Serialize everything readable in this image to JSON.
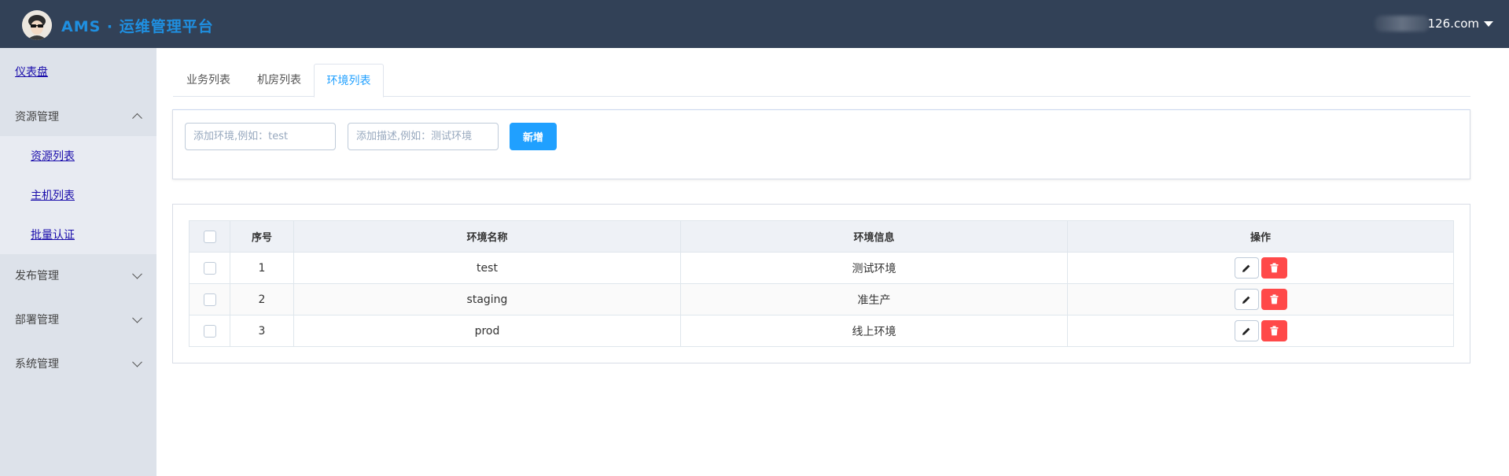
{
  "header": {
    "app_title": "AMS · 运维管理平台",
    "user_email": "126.com"
  },
  "sidebar": {
    "dashboard": "仪表盘",
    "groups": [
      {
        "label": "资源管理",
        "expanded": true,
        "items": [
          "资源列表",
          "主机列表",
          "批量认证"
        ]
      },
      {
        "label": "发布管理",
        "expanded": false
      },
      {
        "label": "部署管理",
        "expanded": false
      },
      {
        "label": "系统管理",
        "expanded": false
      }
    ]
  },
  "tabs": [
    "业务列表",
    "机房列表",
    "环境列表"
  ],
  "active_tab": "环境列表",
  "add_form": {
    "env_placeholder": "添加环境,例如：test",
    "desc_placeholder": "添加描述,例如：测试环境",
    "submit_label": "新增"
  },
  "table": {
    "columns": [
      "序号",
      "环境名称",
      "环境信息",
      "操作"
    ],
    "rows": [
      {
        "index": "1",
        "name": "test",
        "info": "测试环境"
      },
      {
        "index": "2",
        "name": "staging",
        "info": "准生产"
      },
      {
        "index": "3",
        "name": "prod",
        "info": "线上环境"
      }
    ]
  },
  "colors": {
    "header_bg": "#324157",
    "sidebar_bg": "#dde2ea",
    "accent": "#20a0ff",
    "danger": "#ff4949"
  }
}
